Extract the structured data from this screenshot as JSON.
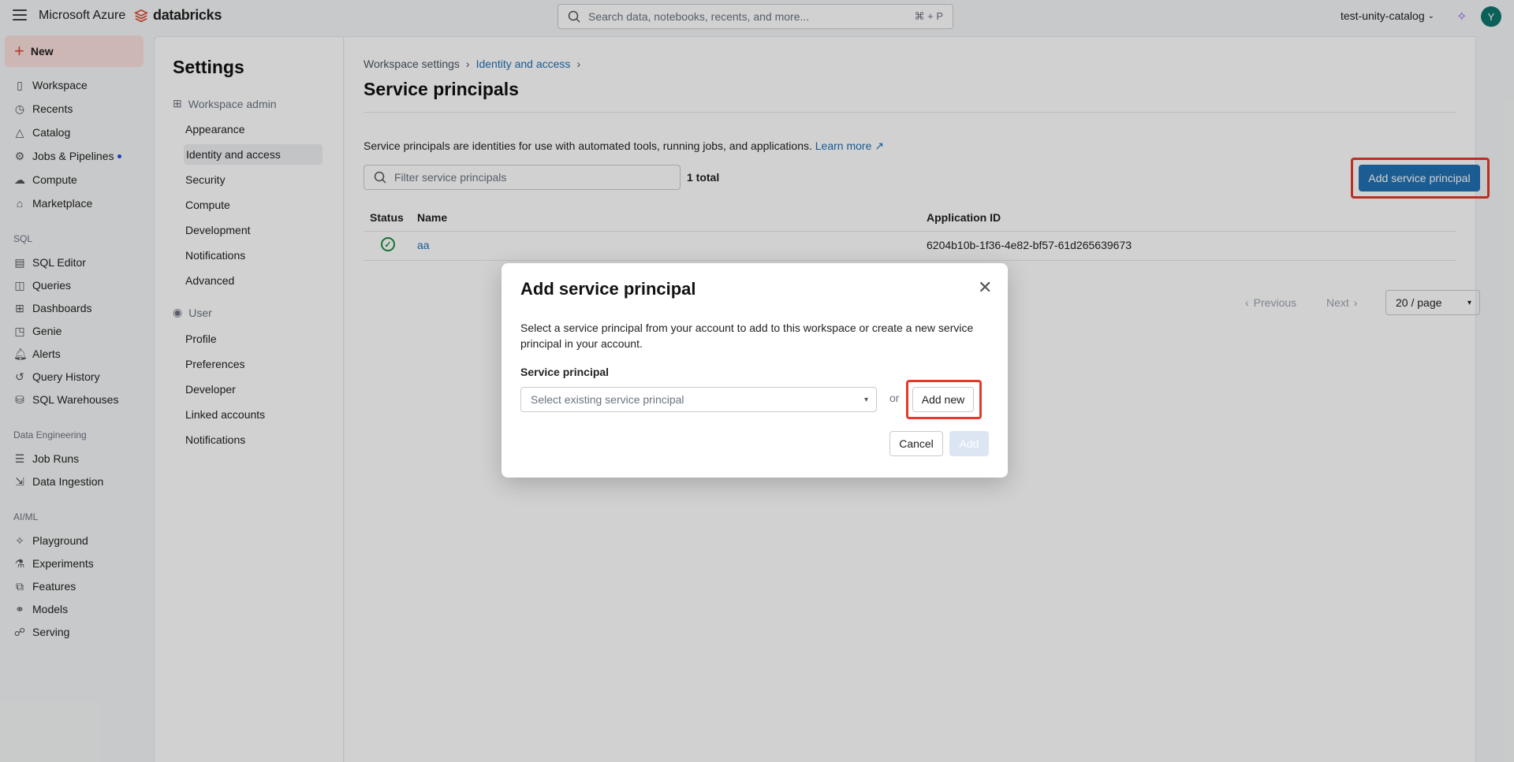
{
  "topbar": {
    "brand_azure": "Microsoft Azure",
    "brand_databricks": "databricks",
    "search_placeholder": "Search data, notebooks, recents, and more...",
    "search_shortcut": "⌘ + P",
    "workspace": "test-unity-catalog",
    "avatar_initial": "Y"
  },
  "leftnav": {
    "new_label": "New",
    "items": [
      {
        "label": "Workspace",
        "icon": "workspace-icon"
      },
      {
        "label": "Recents",
        "icon": "clock-icon"
      },
      {
        "label": "Catalog",
        "icon": "catalog-icon"
      },
      {
        "label": "Jobs & Pipelines",
        "icon": "jobs-icon"
      },
      {
        "label": "Compute",
        "icon": "cloud-icon"
      },
      {
        "label": "Marketplace",
        "icon": "marketplace-icon"
      }
    ],
    "sql_section": "SQL",
    "sql_items": [
      {
        "label": "SQL Editor",
        "icon": "sql-editor-icon"
      },
      {
        "label": "Queries",
        "icon": "queries-icon"
      },
      {
        "label": "Dashboards",
        "icon": "dashboard-icon"
      },
      {
        "label": "Genie",
        "icon": "genie-icon"
      },
      {
        "label": "Alerts",
        "icon": "bell-icon"
      },
      {
        "label": "Query History",
        "icon": "history-icon"
      },
      {
        "label": "SQL Warehouses",
        "icon": "warehouse-icon"
      }
    ],
    "de_section": "Data Engineering",
    "de_items": [
      {
        "label": "Job Runs",
        "icon": "job-runs-icon"
      },
      {
        "label": "Data Ingestion",
        "icon": "ingestion-icon"
      }
    ],
    "ml_section": "AI/ML",
    "ml_items": [
      {
        "label": "Playground",
        "icon": "playground-icon"
      },
      {
        "label": "Experiments",
        "icon": "experiments-icon"
      },
      {
        "label": "Features",
        "icon": "features-icon"
      },
      {
        "label": "Models",
        "icon": "models-icon"
      },
      {
        "label": "Serving",
        "icon": "serving-icon"
      }
    ]
  },
  "settings": {
    "title": "Settings",
    "workspace_admin": "Workspace admin",
    "admin_items": [
      "Appearance",
      "Identity and access",
      "Security",
      "Compute",
      "Development",
      "Notifications",
      "Advanced"
    ],
    "user": "User",
    "user_items": [
      "Profile",
      "Preferences",
      "Developer",
      "Linked accounts",
      "Notifications"
    ]
  },
  "main": {
    "breadcrumb_1": "Workspace settings",
    "breadcrumb_2": "Identity and access",
    "title": "Service principals",
    "description": "Service principals are identities for use with automated tools, running jobs, and applications.",
    "learn_more": "Learn more",
    "filter_placeholder": "Filter service principals",
    "total": "1 total",
    "add_button": "Add service principal",
    "columns": {
      "status": "Status",
      "name": "Name",
      "app_id": "Application ID"
    },
    "rows": [
      {
        "name": "aa",
        "app_id": "6204b10b-1f36-4e82-bf57-61d265639673"
      }
    ],
    "previous": "Previous",
    "next": "Next",
    "per_page": "20 / page"
  },
  "modal": {
    "title": "Add service principal",
    "description": "Select a service principal from your account to add to this workspace or create a new service principal in your account.",
    "label": "Service principal",
    "select_placeholder": "Select existing service principal",
    "or": "or",
    "add_new": "Add new",
    "cancel": "Cancel",
    "add": "Add"
  },
  "colors": {
    "accent": "#2272b4",
    "highlight": "#e53a2a",
    "new_bg": "#fbe0dd"
  }
}
